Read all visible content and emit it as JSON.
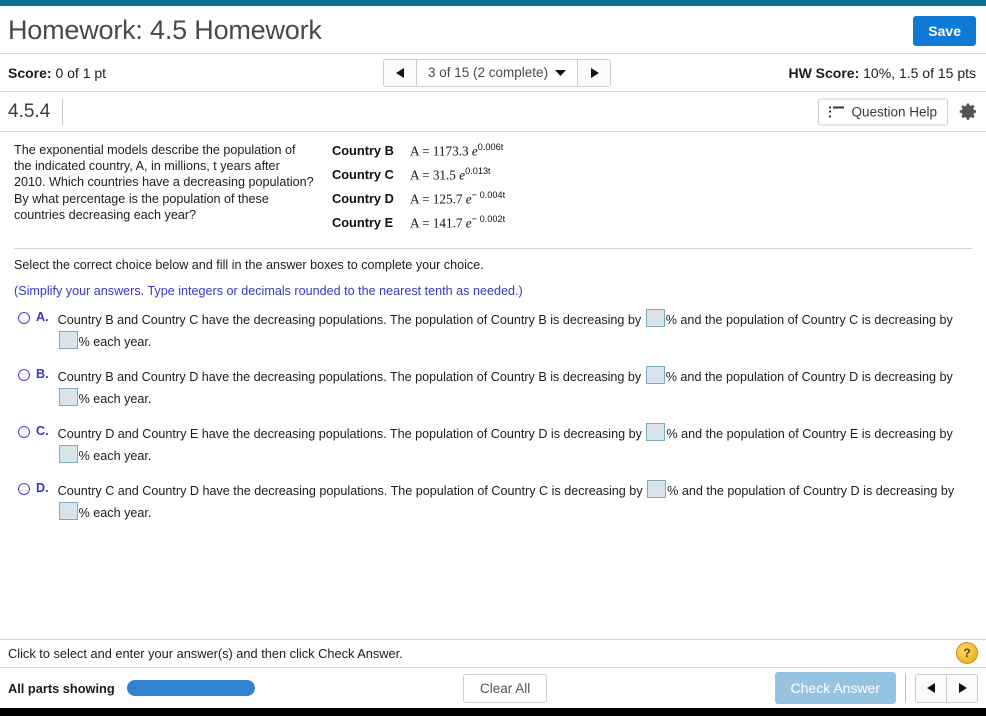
{
  "topbar": {
    "accent_color": "#0b7197"
  },
  "header": {
    "title": "Homework: 4.5 Homework",
    "save_label": "Save",
    "save_color": "#0d7bd6"
  },
  "score_row": {
    "score_label": "Score:",
    "score_value": "0 of 1 pt",
    "nav_prev_icon": "left-triangle-icon",
    "nav_next_icon": "right-triangle-icon",
    "nav_label": "3 of 15 (2 complete)",
    "nav_caret_icon": "caret-down-icon",
    "hw_score_label": "HW Score:",
    "hw_score_value": "10%, 1.5 of 15 pts"
  },
  "question_bar": {
    "question_id": "4.5.4",
    "question_help_label": "Question Help",
    "question_help_icon": "list-icon",
    "settings_icon": "gear-icon"
  },
  "question": {
    "prompt": "The exponential models describe the population of the indicated country, A, in millions, t years after 2010. Which countries have a decreasing population? By what percentage is the population of these countries decreasing each year?",
    "models": [
      {
        "name": "Country B",
        "lhs": "A = 1173.3",
        "base": "e",
        "exponent": "0.006t"
      },
      {
        "name": "Country C",
        "lhs": "A = 31.5",
        "base": "e",
        "exponent": "0.013t"
      },
      {
        "name": "Country D",
        "lhs": "A = 125.7",
        "base": "e",
        "exponent": "− 0.004t"
      },
      {
        "name": "Country E",
        "lhs": "A = 141.7",
        "base": "e",
        "exponent": "− 0.002t"
      }
    ],
    "select_instruction": "Select the correct choice below and fill in the answer boxes to complete your choice.",
    "simplify_note": "(Simplify your answers. Type integers or decimals rounded to the nearest tenth as needed.)",
    "simplify_color": "#3a36c8"
  },
  "choices": [
    {
      "letter": "A.",
      "part1": "Country B and Country C have the decreasing populations. The population of Country B is decreasing by",
      "part2": "% and the population of Country C is decreasing by",
      "part3": "% each year.",
      "box1_value": "",
      "box2_value": ""
    },
    {
      "letter": "B.",
      "part1": "Country B and Country D have the decreasing populations. The population of Country B is decreasing by",
      "part2": "% and the population of Country D is decreasing by",
      "part3": "% each year.",
      "box1_value": "",
      "box2_value": ""
    },
    {
      "letter": "C.",
      "part1": "Country D and Country E have the decreasing populations. The population of Country D is decreasing by",
      "part2": "% and the population of Country E is decreasing by",
      "part3": "% each year.",
      "box1_value": "",
      "box2_value": ""
    },
    {
      "letter": "D.",
      "part1": "Country C and Country D have the decreasing populations. The population of Country C is decreasing by",
      "part2": "% and the population of Country D is decreasing by",
      "part3": "% each year.",
      "box1_value": "",
      "box2_value": ""
    }
  ],
  "footer": {
    "hint": "Click to select and enter your answer(s) and then click Check Answer.",
    "help_badge": "?",
    "parts_label": "All parts showing",
    "progress_color": "#3183d0",
    "clear_all_label": "Clear All",
    "check_answer_label": "Check Answer",
    "check_answer_color": "#95c4e3",
    "prev_icon": "left-triangle-icon",
    "next_icon": "right-triangle-icon"
  }
}
